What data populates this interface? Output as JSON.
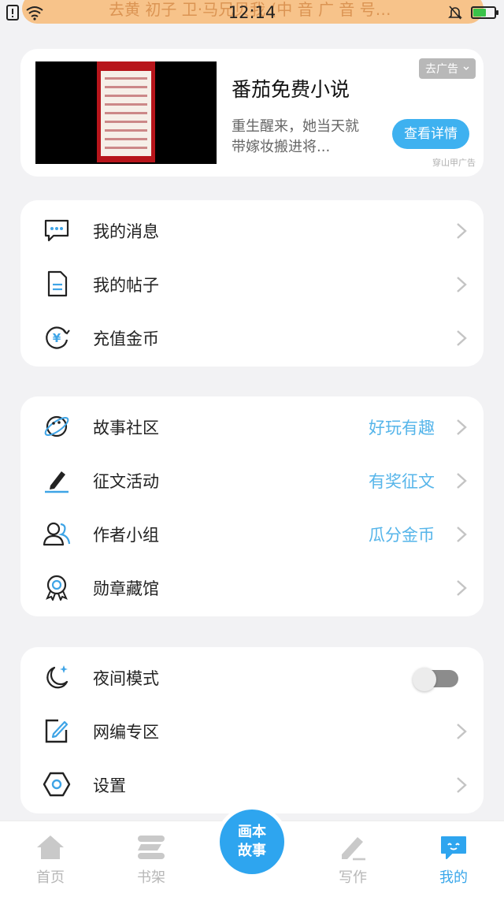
{
  "status_bar": {
    "time": "12:14",
    "notification_ghost": "去黄 初子 卫·马兄贝我 (中 音 广 音 号…"
  },
  "ad": {
    "title": "番茄免费小说",
    "description": "重生醒来，她当天就带嫁妆搬进将...",
    "remove_label": "去广告",
    "detail_button": "查看详情",
    "source": "穿山甲广告"
  },
  "menu_group_1": [
    {
      "label": "我的消息",
      "icon": "chat-bubble-icon"
    },
    {
      "label": "我的帖子",
      "icon": "document-icon"
    },
    {
      "label": "充值金币",
      "icon": "yen-coin-icon"
    }
  ],
  "menu_group_2": [
    {
      "label": "故事社区",
      "tag": "好玩有趣",
      "icon": "planet-icon"
    },
    {
      "label": "征文活动",
      "tag": "有奖征文",
      "icon": "pen-icon"
    },
    {
      "label": "作者小组",
      "tag": "瓜分金币",
      "icon": "group-icon"
    },
    {
      "label": "勋章藏馆",
      "tag": "",
      "icon": "medal-icon"
    }
  ],
  "menu_group_3": [
    {
      "label": "夜间模式",
      "icon": "moon-icon",
      "toggle_on": false
    },
    {
      "label": "网编专区",
      "icon": "edit-square-icon"
    },
    {
      "label": "设置",
      "icon": "hexagon-settings-icon"
    }
  ],
  "tabbar": {
    "tabs": [
      {
        "label": "首页",
        "icon": "home-icon"
      },
      {
        "label": "书架",
        "icon": "bookshelf-icon"
      },
      {
        "label": "写作",
        "icon": "write-icon"
      },
      {
        "label": "我的",
        "icon": "profile-chat-icon",
        "active": true
      }
    ],
    "center_line1": "画本",
    "center_line2": "故事"
  },
  "colors": {
    "accent": "#3eb1f0",
    "tag_blue": "#56b5ea",
    "background": "#f2f2f4"
  }
}
